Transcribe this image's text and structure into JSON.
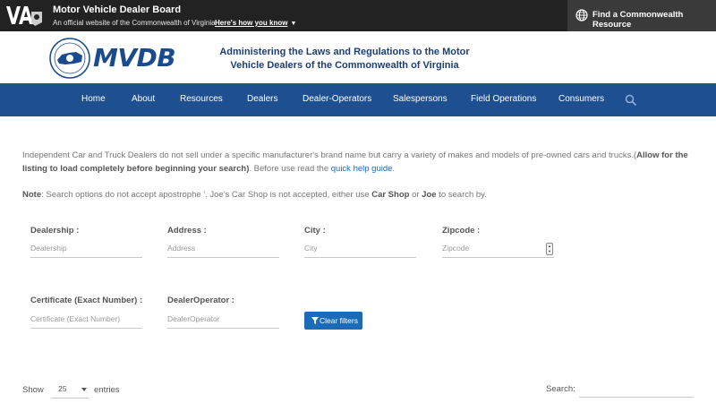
{
  "topbar": {
    "logo_text": "VA",
    "title": "Motor Vehicle Dealer Board",
    "subtitle": "An official website of the Commonwealth of Virginia",
    "how_link": "Here's how you know",
    "find_resource": "Find a Commonwealth Resource"
  },
  "brand": {
    "wordmark": "MVDB",
    "tagline_line1": "Administering the Laws and Regulations to the Motor",
    "tagline_line2": "Vehicle Dealers of the Commonwealth of Virginia"
  },
  "nav": {
    "items": [
      "Home",
      "About",
      "Resources",
      "Dealers",
      "Dealer-Operators",
      "Salespersons",
      "Field Operations",
      "Consumers"
    ]
  },
  "intro": {
    "text1": "Independent Car and Truck Dealers do not sell under a specific manufacturer's brand name but carry a variety of makes and models of pre-owned cars and trucks.(",
    "bold1": "Allow for the listing to load completely before beginning your search)",
    "text2": ". Before use read the ",
    "link": "quick help guide",
    "text3": "."
  },
  "note": {
    "label": "Note",
    "text1": ": Search options do not accept apostrophe '. Joe's Car Shop is not accepted, either use ",
    "bold1": "Car Shop",
    "text2": " or ",
    "bold2": "Joe",
    "text3": " to search by."
  },
  "filters": {
    "dealership": {
      "label": "Dealership :",
      "placeholder": "Dealership"
    },
    "address": {
      "label": "Address :",
      "placeholder": "Address"
    },
    "city": {
      "label": "City :",
      "placeholder": "City"
    },
    "zipcode": {
      "label": "Zipcode :",
      "placeholder": "Zipcode"
    },
    "certificate": {
      "label": "Certificate (Exact Number) :",
      "placeholder": "Certificate (Exact Number)"
    },
    "dealer_operator": {
      "label": "DealerOperator :",
      "placeholder": "DealerOperator"
    },
    "clear_button": "Clear filters"
  },
  "table_controls": {
    "show_label": "Show",
    "entries_value": "25",
    "entries_label": "entries",
    "search_label": "Search:"
  },
  "colors": {
    "topbar": "#222222",
    "nav": "#1d4f91",
    "brand_blue": "#1b4b8c",
    "button": "#1a6bb8"
  }
}
